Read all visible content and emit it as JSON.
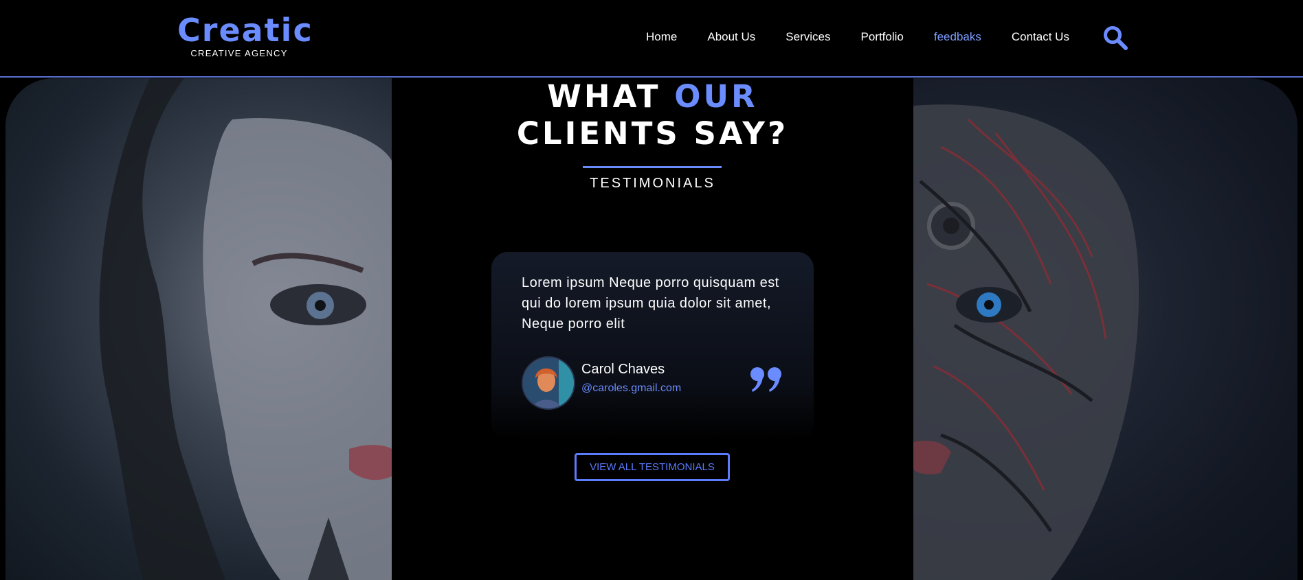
{
  "brand": {
    "name": "Creatic",
    "tagline": "CREATIVE AGENCY",
    "accent_color": "#6b8cff"
  },
  "nav": {
    "items": [
      {
        "label": "Home",
        "active": false
      },
      {
        "label": "About Us",
        "active": false
      },
      {
        "label": "Services",
        "active": false
      },
      {
        "label": "Portfolio",
        "active": false
      },
      {
        "label": "feedbaks",
        "active": true
      },
      {
        "label": "Contact Us",
        "active": false
      }
    ],
    "search_icon": "search-icon"
  },
  "section": {
    "heading_line1_a": "WHAT",
    "heading_line1_b": "OUR",
    "heading_line2": "CLIENTS SAY?",
    "subheading": "TESTIMONIALS"
  },
  "testimonial": {
    "text": "Lorem ipsum Neque porro quisquam est qui do lorem ipsum quia dolor sit amet, Neque porro elit",
    "name": "Carol Chaves",
    "email": "@caroles.gmail.com",
    "quote_icon": "quote-icon"
  },
  "cta": {
    "label": "VIEW ALL TESTIMONIALS"
  }
}
